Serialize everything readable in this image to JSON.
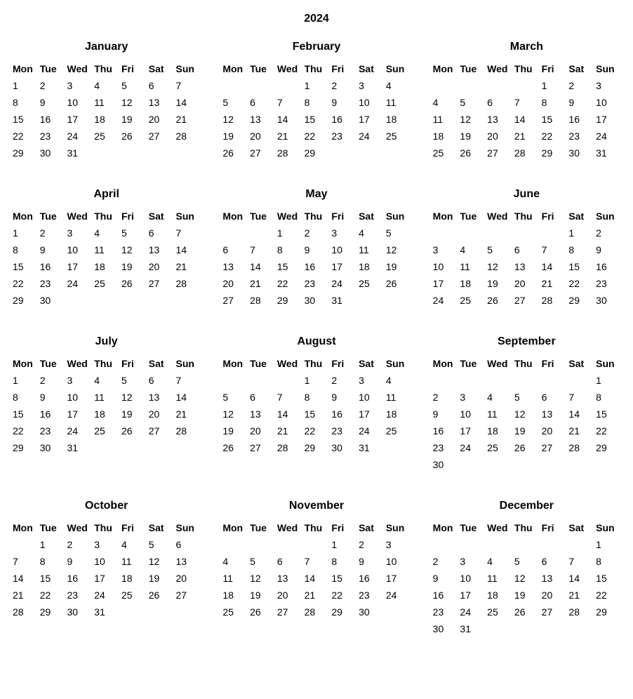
{
  "year_label": "2024",
  "weekday_labels": [
    "Mon",
    "Tue",
    "Wed",
    "Thu",
    "Fri",
    "Sat",
    "Sun"
  ],
  "months": [
    {
      "name": "January",
      "offset": 0,
      "days": 31
    },
    {
      "name": "February",
      "offset": 3,
      "days": 29
    },
    {
      "name": "March",
      "offset": 4,
      "days": 31
    },
    {
      "name": "April",
      "offset": 0,
      "days": 30
    },
    {
      "name": "May",
      "offset": 2,
      "days": 31
    },
    {
      "name": "June",
      "offset": 5,
      "days": 30
    },
    {
      "name": "July",
      "offset": 0,
      "days": 31
    },
    {
      "name": "August",
      "offset": 3,
      "days": 31
    },
    {
      "name": "September",
      "offset": 6,
      "days": 30
    },
    {
      "name": "October",
      "offset": 1,
      "days": 31
    },
    {
      "name": "November",
      "offset": 4,
      "days": 30
    },
    {
      "name": "December",
      "offset": 6,
      "days": 31
    }
  ]
}
